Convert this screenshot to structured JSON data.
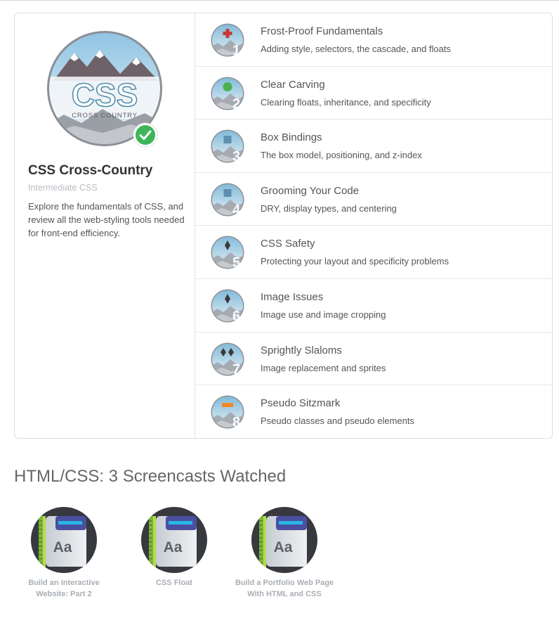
{
  "course": {
    "badge_text": "CSS",
    "badge_subtext": "CROSS COUNTRY",
    "title": "CSS Cross-Country",
    "level": "Intermediate CSS",
    "description": "Explore the fundamentals of CSS, and review all the web-styling tools needed for front-end efficiency.",
    "completed": true
  },
  "levels": [
    {
      "number": "1",
      "title": "Frost-Proof Fundamentals",
      "subtitle": "Adding style, selectors, the cascade, and floats",
      "icon": "red-cross-icon",
      "color": "#c33b36"
    },
    {
      "number": "2",
      "title": "Clear Carving",
      "subtitle": "Clearing floats, inheritance, and specificity",
      "icon": "green-circle-icon",
      "color": "#4caf50"
    },
    {
      "number": "3",
      "title": "Box Bindings",
      "subtitle": "The box model, positioning, and z-index",
      "icon": "blue-square-icon",
      "color": "#5f8fb0"
    },
    {
      "number": "4",
      "title": "Grooming Your Code",
      "subtitle": "DRY, display types, and centering",
      "icon": "blue-square-icon",
      "color": "#5f8fb0"
    },
    {
      "number": "5",
      "title": "CSS Safety",
      "subtitle": "Protecting your layout and specificity problems",
      "icon": "black-diamond-icon",
      "color": "#3a3a3a"
    },
    {
      "number": "6",
      "title": "Image Issues",
      "subtitle": "Image use and image cropping",
      "icon": "black-diamond-icon",
      "color": "#3a3a3a"
    },
    {
      "number": "7",
      "title": "Sprightly Slaloms",
      "subtitle": "Image replacement and sprites",
      "icon": "double-diamond-icon",
      "color": "#3a3a3a"
    },
    {
      "number": "8",
      "title": "Pseudo Sitzmark",
      "subtitle": "Pseudo classes and pseudo elements",
      "icon": "orange-bar-icon",
      "color": "#f08a24"
    }
  ],
  "screencasts": {
    "heading": "HTML/CSS: 3 Screencasts Watched",
    "items": [
      {
        "label": "Build an Interactive Website: Part 2",
        "icon_text": "Aa"
      },
      {
        "label": "CSS Float",
        "icon_text": "Aa"
      },
      {
        "label": "Build a Portfolio Web Page With HTML and CSS",
        "icon_text": "Aa"
      }
    ]
  }
}
